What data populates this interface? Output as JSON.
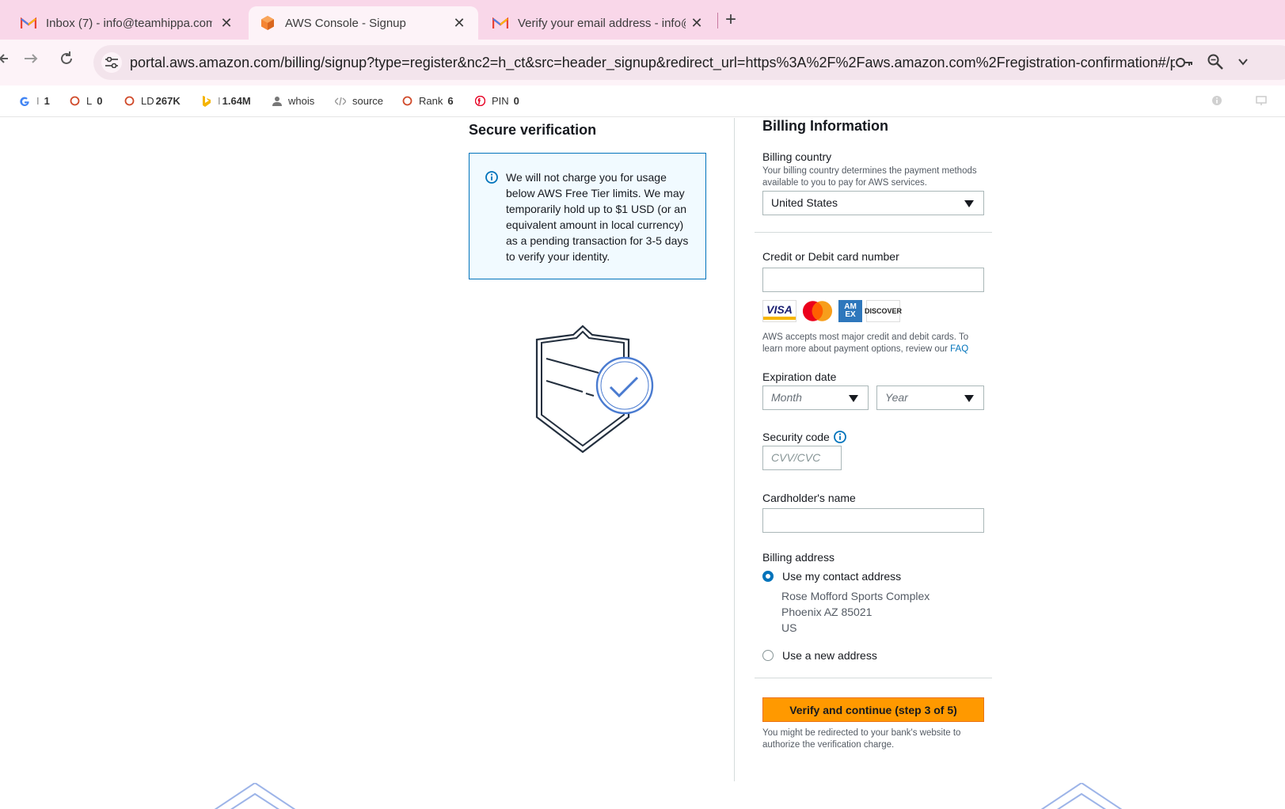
{
  "browser": {
    "tabs": [
      {
        "title": "Inbox (7) - info@teamhippa.com",
        "icon": "gmail-icon",
        "active": false
      },
      {
        "title": "AWS Console - Signup",
        "icon": "aws-icon",
        "active": true
      },
      {
        "title": "Verify your email address - info@",
        "icon": "gmail-icon",
        "active": false
      }
    ],
    "new_tab": "+",
    "close_glyph": "✕",
    "url": "portal.aws.amazon.com/billing/signup?type=register&nc2=h_ct&src=header_signup&redirect_url=https%3A%2F%2Faws.amazon.com%2Fregistration-confirmation#/payment..."
  },
  "bookmarks": [
    {
      "label": "I",
      "value": "1",
      "icon": "google-icon"
    },
    {
      "label": "L",
      "value": "0",
      "icon": "circle-icon"
    },
    {
      "label": "LD",
      "value": "267K",
      "icon": "circle-icon"
    },
    {
      "label": "I",
      "value": "1.64M",
      "icon": "bing-icon"
    },
    {
      "label": "whois",
      "value": "",
      "icon": "person-icon"
    },
    {
      "label": "source",
      "value": "",
      "icon": "code-icon"
    },
    {
      "label": "Rank",
      "value": "6",
      "icon": "circle-icon"
    },
    {
      "label": "PIN",
      "value": "0",
      "icon": "pinterest-icon"
    }
  ],
  "verification": {
    "title": "Secure verification",
    "notice": "We will not charge you for usage below AWS Free Tier limits. We may temporarily hold up to $1 USD (or an equivalent amount in local currency) as a pending transaction for 3-5 days to verify your identity."
  },
  "billing": {
    "title": "Billing Information",
    "country_label": "Billing country",
    "country_hint": "Your billing country determines the payment methods available to you to pay for AWS services.",
    "country_value": "United States",
    "card_label": "Credit or Debit card number",
    "card_value": "",
    "card_brands": [
      "VISA",
      "Mastercard",
      "AM EX",
      "DISCOVER"
    ],
    "accepts_text": "AWS accepts most major credit and debit cards. To learn more about payment options, review our",
    "faq_link": "FAQ",
    "expiration_label": "Expiration date",
    "month_placeholder": "Month",
    "year_placeholder": "Year",
    "security_label": "Security code",
    "cvv_placeholder": "CVV/CVC",
    "name_label": "Cardholder's name",
    "name_value": "",
    "address_label": "Billing address",
    "address_options": [
      {
        "label": "Use my contact address",
        "selected": true
      },
      {
        "label": "Use a new address",
        "selected": false
      }
    ],
    "contact_address": [
      "Rose Mofford Sports Complex",
      "Phoenix AZ 85021",
      "US"
    ],
    "submit_label": "Verify and continue (step 3 of 5)",
    "submit_note": "You might be redirected to your bank's website to authorize the verification charge."
  },
  "colors": {
    "accent": "#0073bb",
    "cta": "#ff9900",
    "tabstrip": "#f9d7e9"
  }
}
